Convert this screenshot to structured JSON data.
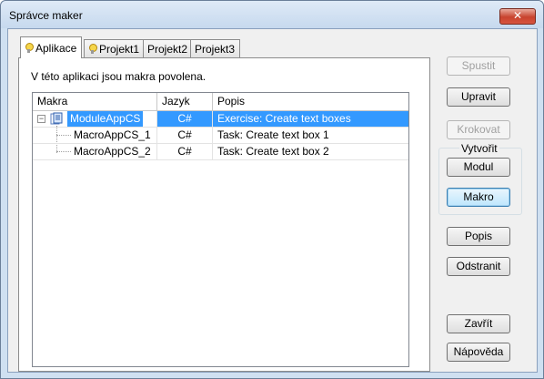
{
  "window": {
    "title": "Správce maker",
    "close_label": "✕"
  },
  "tabs": [
    {
      "label": "Aplikace",
      "has_icon": true,
      "active": true
    },
    {
      "label": "Projekt1",
      "has_icon": true,
      "active": false
    },
    {
      "label": "Projekt2",
      "has_icon": false,
      "active": false
    },
    {
      "label": "Projekt3",
      "has_icon": false,
      "active": false
    }
  ],
  "panel": {
    "info_text": "V této aplikaci jsou makra povolena."
  },
  "table": {
    "columns": [
      "Makra",
      "Jazyk",
      "Popis"
    ],
    "rows": [
      {
        "name": "ModuleAppCS",
        "language": "C#",
        "description": "Exercise: Create text boxes",
        "selected": true,
        "expander": "−"
      },
      {
        "name": "MacroAppCS_1",
        "language": "C#",
        "description": "Task: Create text box 1",
        "selected": false
      },
      {
        "name": "MacroAppCS_2",
        "language": "C#",
        "description": "Task: Create text box 2",
        "selected": false
      }
    ]
  },
  "buttons": {
    "run": "Spustit",
    "edit": "Upravit",
    "step": "Krokovat",
    "create_group": "Vytvořit",
    "module": "Modul",
    "macro": "Makro",
    "description": "Popis",
    "delete": "Odstranit",
    "close": "Zavřít",
    "help": "Nápověda"
  },
  "colors": {
    "selection": "#3399ff",
    "title_bg": "#cfe0f1",
    "close_button": "#c8432e"
  }
}
